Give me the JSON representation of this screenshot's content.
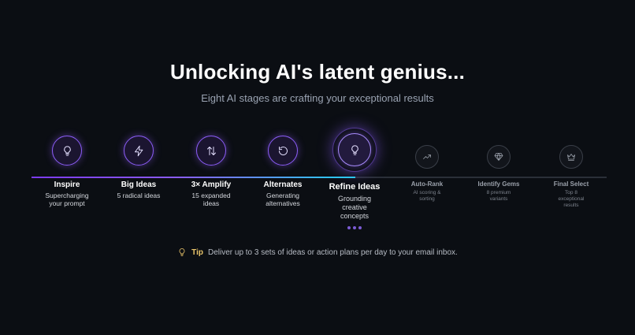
{
  "header": {
    "title": "Unlocking AI's latent genius...",
    "subtitle": "Eight AI stages are crafting your exceptional results"
  },
  "progress": {
    "completed_stages": 4,
    "active_stage": 5,
    "total_stages": 8
  },
  "stages": [
    {
      "name": "Inspire",
      "desc": [
        "Supercharging",
        "your prompt"
      ],
      "icon": "lightbulb-icon",
      "state": "done"
    },
    {
      "name": "Big Ideas",
      "desc": [
        "5 radical ideas"
      ],
      "icon": "lightning-icon",
      "state": "done"
    },
    {
      "name": "3× Amplify",
      "desc": [
        "15 expanded",
        "ideas"
      ],
      "icon": "swap-arrows-icon",
      "state": "done"
    },
    {
      "name": "Alternates",
      "desc": [
        "Generating",
        "alternatives"
      ],
      "icon": "refresh-icon",
      "state": "done"
    },
    {
      "name": "Refine Ideas",
      "desc": [
        "Grounding",
        "creative",
        "concepts"
      ],
      "icon": "lightbulb-icon",
      "state": "active"
    },
    {
      "name": "Auto-Rank",
      "desc": [
        "AI scoring &",
        "sorting"
      ],
      "icon": "trend-up-icon",
      "state": "pending"
    },
    {
      "name": "Identify Gems",
      "desc": [
        "8 premium",
        "variants"
      ],
      "icon": "gem-icon",
      "state": "pending"
    },
    {
      "name": "Final Select",
      "desc": [
        "Top 8",
        "exceptional",
        "results"
      ],
      "icon": "crown-icon",
      "state": "pending"
    }
  ],
  "tip": {
    "label": "Tip",
    "text": "Deliver up to 3 sets of ideas or action plans per day to your email inbox.",
    "icon": "lightbulb-icon"
  },
  "colors": {
    "background": "#0b0e13",
    "accent": "#8b5cf6",
    "accent_cyan": "#22d3ee",
    "tip": "#e9c46a"
  }
}
